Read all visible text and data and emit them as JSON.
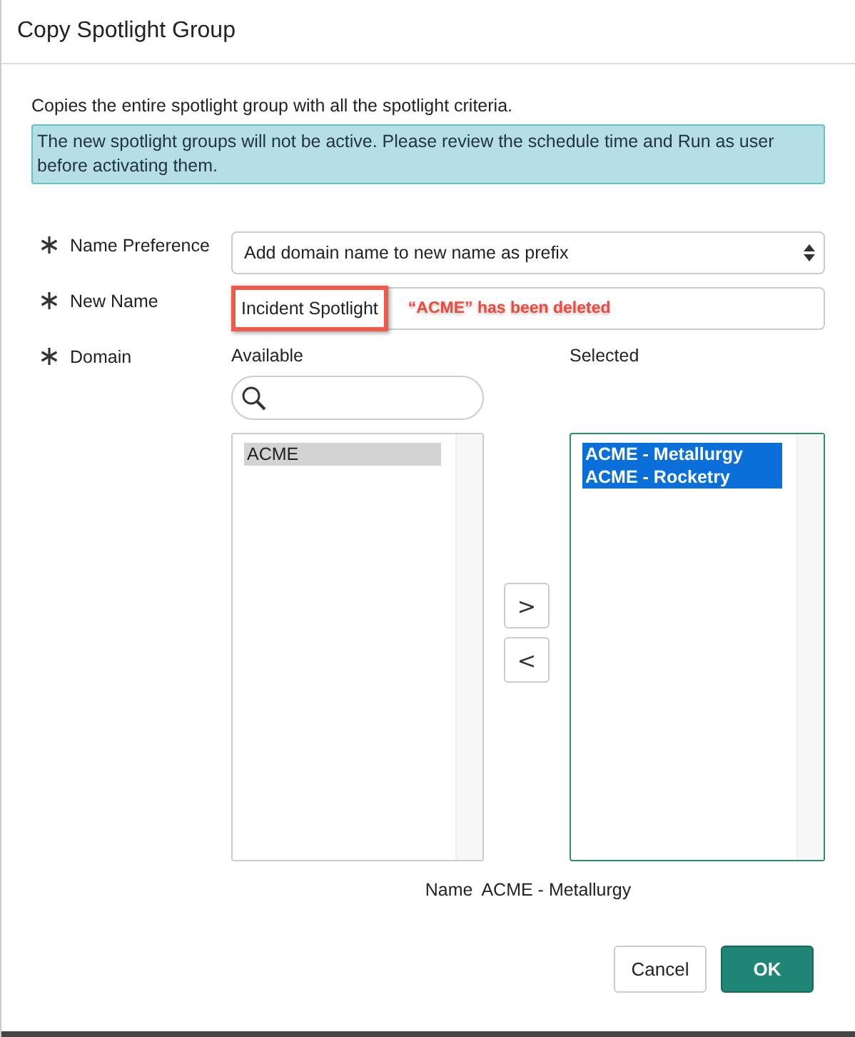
{
  "dialog": {
    "title": "Copy Spotlight Group"
  },
  "description": "Copies the entire spotlight group with all the spotlight criteria.",
  "info": "The new spotlight groups will not be active. Please review the schedule time and Run as user before activating them.",
  "fields": [
    {
      "kind": "select",
      "label": "Name Preference",
      "required": true,
      "value": "Add domain name to new name as prefix"
    },
    {
      "kind": "text",
      "label": "New Name",
      "required": true,
      "value": "Incident Spotlight",
      "highlighted": true,
      "annotation": "“ACME” has been deleted"
    },
    {
      "kind": "slushbucket",
      "label": "Domain",
      "required": true,
      "available": {
        "heading": "Available",
        "focused": false,
        "items": [
          {
            "label": "ACME",
            "selected": true
          }
        ]
      },
      "chosen": {
        "heading": "Selected",
        "focused": true,
        "items": [
          {
            "label": "ACME - Metallurgy",
            "selected": true
          },
          {
            "label": "ACME - Rocketry",
            "selected": true
          }
        ]
      },
      "move_buttons": [
        ">",
        "<"
      ],
      "name_label": "Name",
      "name_value": "ACME - Metallurgy"
    }
  ],
  "buttons": [
    {
      "label": "Cancel",
      "primary": false
    },
    {
      "label": "OK",
      "primary": true
    }
  ]
}
